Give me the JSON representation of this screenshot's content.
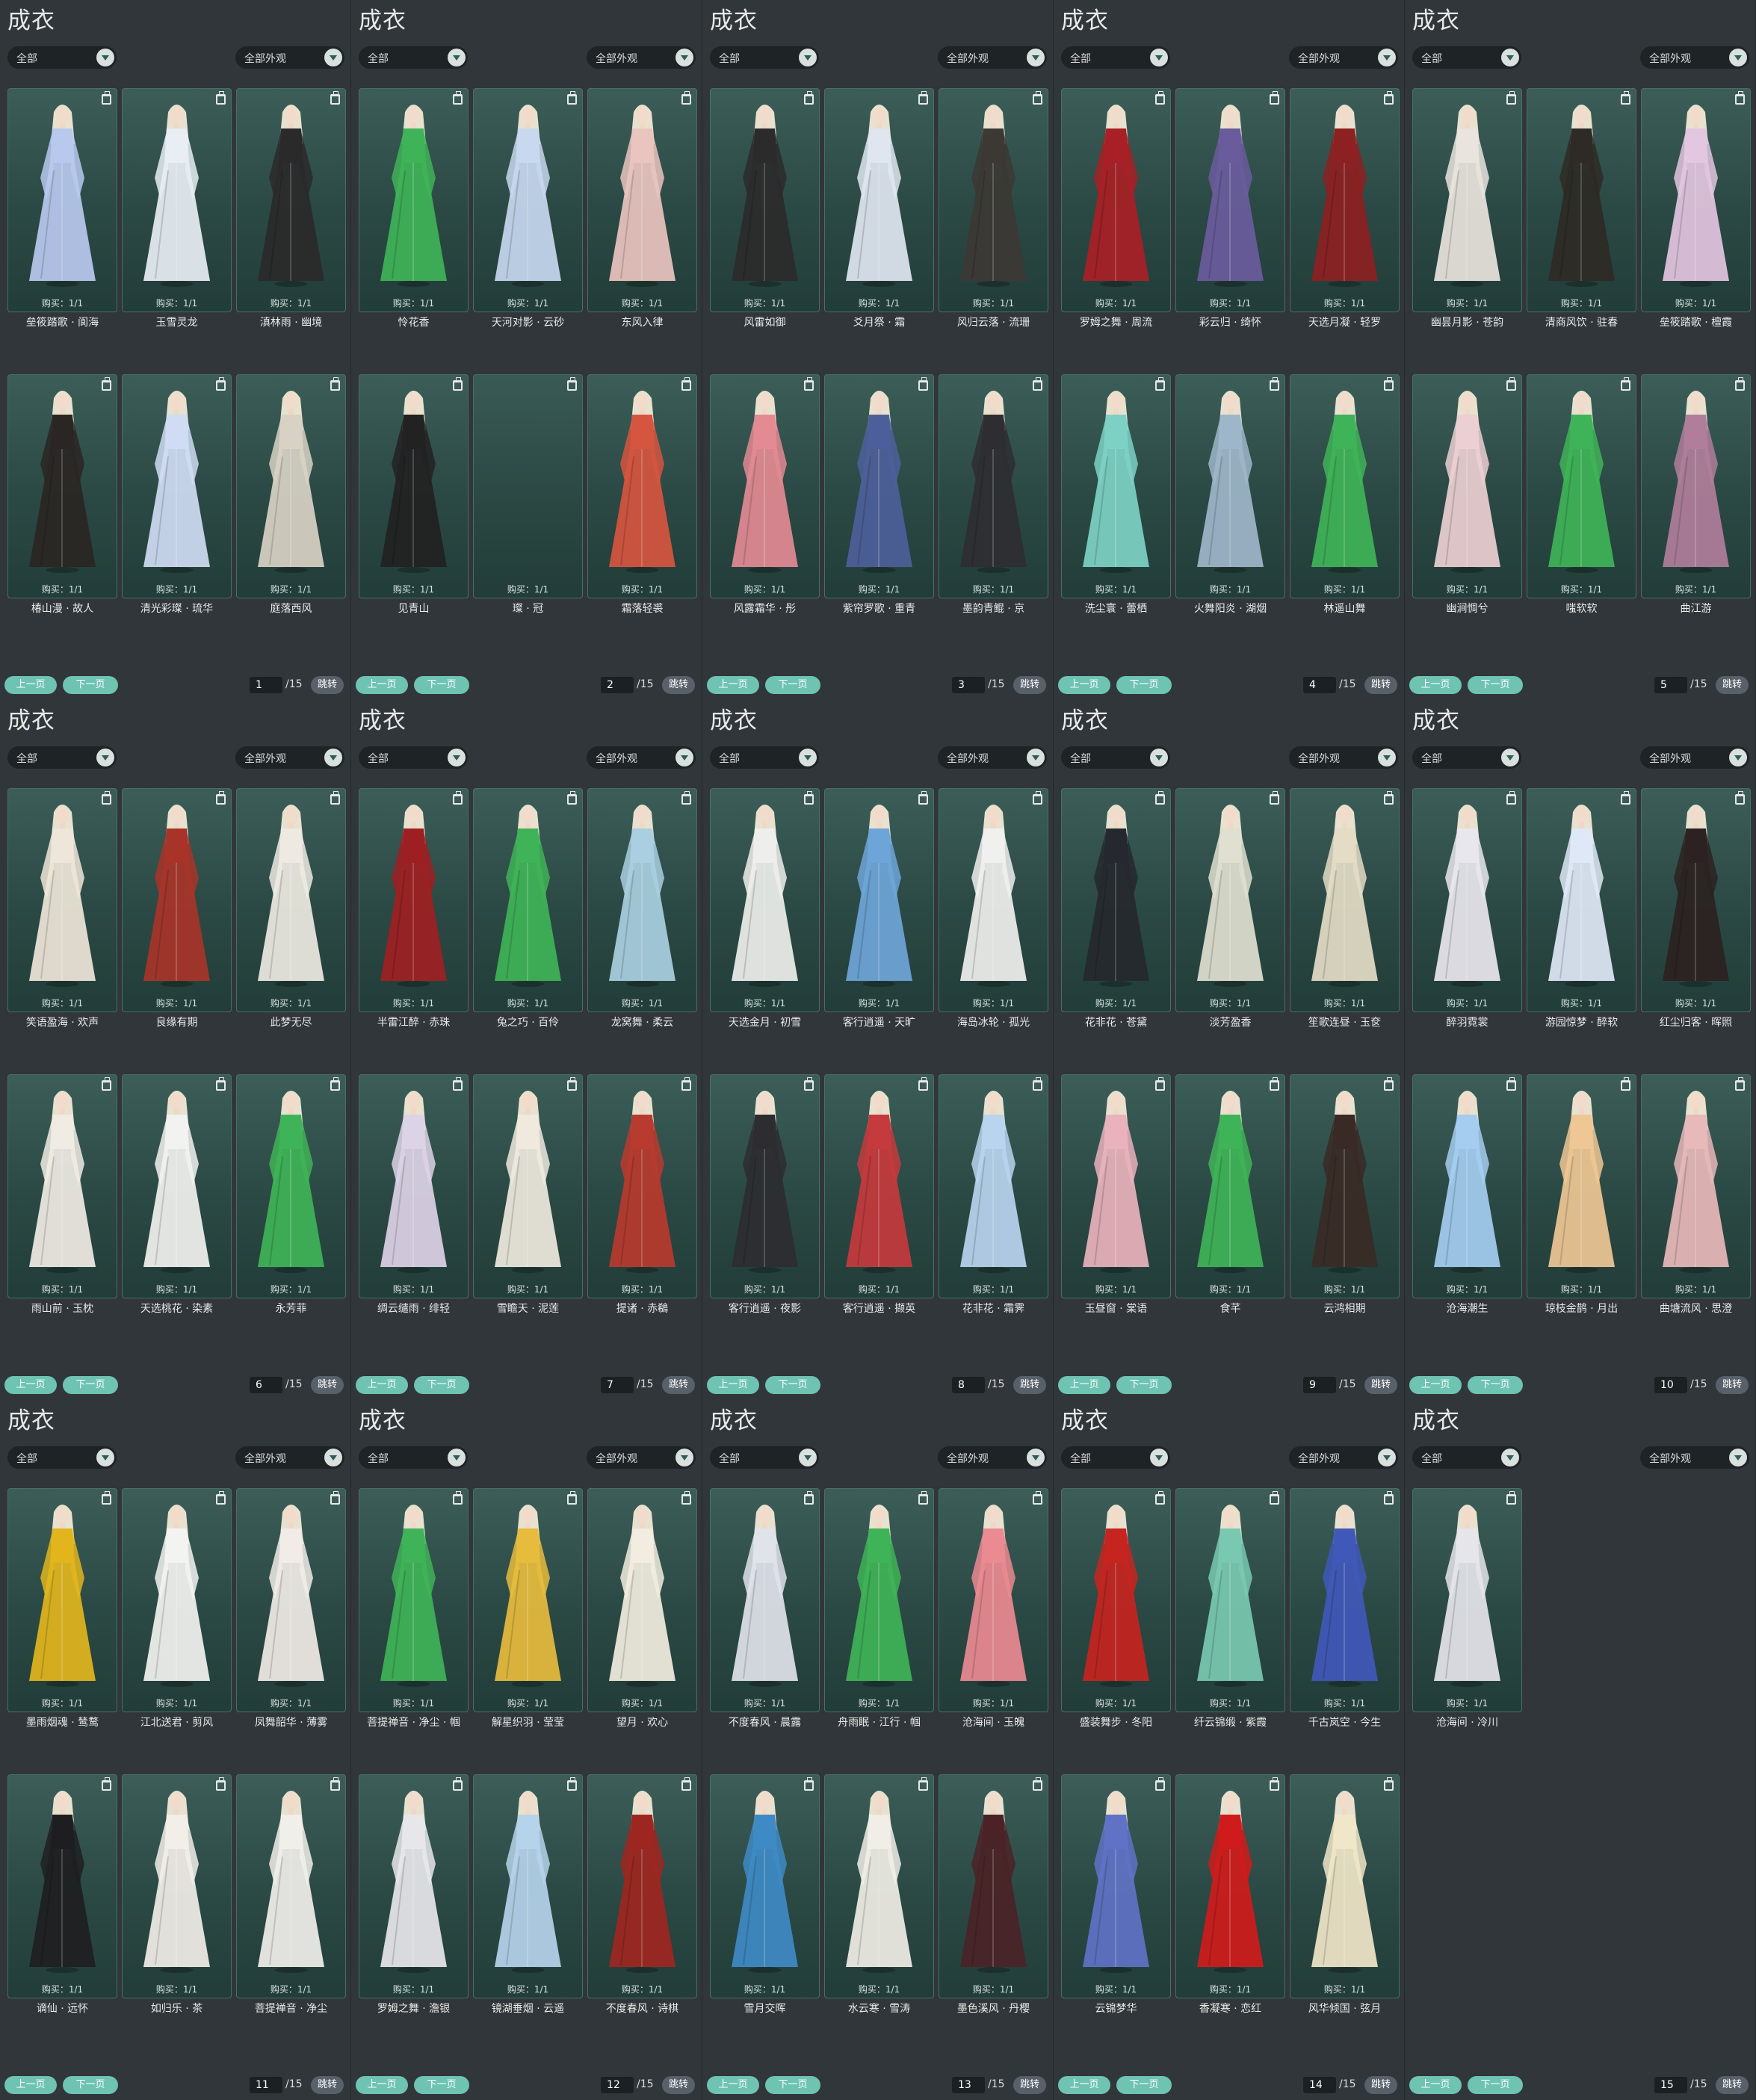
{
  "icons": {
    "trash": "trash-icon",
    "dropdown": "chevron-down-icon"
  },
  "colors": {
    "page_bg": "#30363a",
    "card_bg": "#2b4944",
    "button": "#6fc3b3"
  },
  "panels": [
    {
      "title": "成衣",
      "filter1": "全部",
      "filter2": "全部外观",
      "prev": "上一页",
      "next": "下一页",
      "page": "1",
      "total": "/15",
      "jump": "跳转",
      "items": [
        {
          "name": "垒筱踏歌 · 阆海",
          "buy": "购买：1/1",
          "color": "#b9c9ee"
        },
        {
          "name": "玉雪灵龙",
          "buy": "购买：1/1",
          "color": "#e8eef4"
        },
        {
          "name": "滇林雨 · 幽境",
          "buy": "购买：1/1",
          "color": "#2a2a2a"
        },
        {
          "name": "椿山漫 · 故人",
          "buy": "购买：1/1",
          "color": "#2a2623"
        },
        {
          "name": "清光彩璨 · 琉华",
          "buy": "购买：1/1",
          "color": "#cfdcf3"
        },
        {
          "name": "庭落西风",
          "buy": "购买：1/1",
          "color": "#d8d2c4"
        }
      ]
    },
    {
      "title": "成衣",
      "filter1": "全部",
      "filter2": "全部外观",
      "prev": "上一页",
      "next": "下一页",
      "page": "2",
      "total": "/15",
      "jump": "跳转",
      "items": [
        {
          "name": "怜花香",
          "buy": "购买：1/1",
          "color": "#3fb357"
        },
        {
          "name": "天河对影 · 云砂",
          "buy": "购买：1/1",
          "color": "#c7d8ef"
        },
        {
          "name": "东风入律",
          "buy": "购买：1/1",
          "color": "#eac4bf"
        },
        {
          "name": "见青山",
          "buy": "购买：1/1",
          "color": "#222222"
        },
        {
          "name": "璨 · 冠",
          "buy": "购买：1/1",
          "color": ""
        },
        {
          "name": "霜落轻裘",
          "buy": "购买：1/1",
          "color": "#d6553f"
        }
      ]
    },
    {
      "title": "成衣",
      "filter1": "全部",
      "filter2": "全部外观",
      "prev": "上一页",
      "next": "下一页",
      "page": "3",
      "total": "/15",
      "jump": "跳转",
      "items": [
        {
          "name": "风雷如御",
          "buy": "购买：1/1",
          "color": "#2b2b2b"
        },
        {
          "name": "爻月祭 · 霜",
          "buy": "购买：1/1",
          "color": "#dfe6f0"
        },
        {
          "name": "风归云落 · 流珊",
          "buy": "购买：1/1",
          "color": "#3c3834"
        },
        {
          "name": "风露霜华 · 彤",
          "buy": "购买：1/1",
          "color": "#e38a93"
        },
        {
          "name": "紫帘罗歌 · 重青",
          "buy": "购买：1/1",
          "color": "#4d5f9a"
        },
        {
          "name": "墨韵青鲲 · 京",
          "buy": "购买：1/1",
          "color": "#2e2e31"
        }
      ]
    },
    {
      "title": "成衣",
      "filter1": "全部",
      "filter2": "全部外观",
      "prev": "上一页",
      "next": "下一页",
      "page": "4",
      "total": "/15",
      "jump": "跳转",
      "items": [
        {
          "name": "罗姆之舞 · 周流",
          "buy": "购买：1/1",
          "color": "#a81f25"
        },
        {
          "name": "彩云归 · 绮怀",
          "buy": "购买：1/1",
          "color": "#6a5c9c"
        },
        {
          "name": "天选月凝 · 轻罗",
          "buy": "购买：1/1",
          "color": "#8d2021"
        },
        {
          "name": "洗尘寰 · 蕾栖",
          "buy": "购买：1/1",
          "color": "#7dd1c4"
        },
        {
          "name": "火舞阳炎 · 湖烟",
          "buy": "购买：1/1",
          "color": "#9eb6c9"
        },
        {
          "name": "林遥山舞",
          "buy": "购买：1/1",
          "color": "#3fb357"
        }
      ]
    },
    {
      "title": "成衣",
      "filter1": "全部",
      "filter2": "全部外观",
      "prev": "上一页",
      "next": "下一页",
      "page": "5",
      "total": "/15",
      "jump": "跳转",
      "items": [
        {
          "name": "幽昙月影 · 苍韵",
          "buy": "购买：1/1",
          "color": "#e9e4dd"
        },
        {
          "name": "清商风饮 · 驻春",
          "buy": "购买：1/1",
          "color": "#2e2a25"
        },
        {
          "name": "垒筱踏歌 · 檀霞",
          "buy": "购买：1/1",
          "color": "#e3c6df"
        },
        {
          "name": "幽涧惆兮",
          "buy": "购买：1/1",
          "color": "#eccfd3"
        },
        {
          "name": "嗤软软",
          "buy": "购买：1/1",
          "color": "#3fb357"
        },
        {
          "name": "曲江游",
          "buy": "购买：1/1",
          "color": "#b07e9a"
        }
      ]
    },
    {
      "title": "成衣",
      "filter1": "全部",
      "filter2": "全部外观",
      "prev": "上一页",
      "next": "下一页",
      "page": "6",
      "total": "/15",
      "jump": "跳转",
      "items": [
        {
          "name": "笑语盈海 · 欢声",
          "buy": "购买：1/1",
          "color": "#eee6d8"
        },
        {
          "name": "良缘有期",
          "buy": "购买：1/1",
          "color": "#a83429"
        },
        {
          "name": "此梦无尽",
          "buy": "购买：1/1",
          "color": "#eeeae2"
        },
        {
          "name": "雨山前 · 玉枕",
          "buy": "购买：1/1",
          "color": "#f0ece4"
        },
        {
          "name": "天选桃花 · 染素",
          "buy": "购买：1/1",
          "color": "#f2f2f0"
        },
        {
          "name": "永芳菲",
          "buy": "购买：1/1",
          "color": "#3fb357"
        }
      ]
    },
    {
      "title": "成衣",
      "filter1": "全部",
      "filter2": "全部外观",
      "prev": "上一页",
      "next": "下一页",
      "page": "7",
      "total": "/15",
      "jump": "跳转",
      "items": [
        {
          "name": "半雷江醉 · 赤珠",
          "buy": "购买：1/1",
          "color": "#9e1f22"
        },
        {
          "name": "兔之巧 · 百伶",
          "buy": "购买：1/1",
          "color": "#3fb357"
        },
        {
          "name": "龙窝舞 · 柔云",
          "buy": "购买：1/1",
          "color": "#a9cfe0"
        },
        {
          "name": "绸云缱雨 · 绯轻",
          "buy": "购买：1/1",
          "color": "#ddd3e6"
        },
        {
          "name": "雪瞻天 · 泥莲",
          "buy": "购买：1/1",
          "color": "#efe9de"
        },
        {
          "name": "提诸 · 赤鵗",
          "buy": "购买：1/1",
          "color": "#b93a2e"
        }
      ]
    },
    {
      "title": "成衣",
      "filter1": "全部",
      "filter2": "全部外观",
      "prev": "上一页",
      "next": "下一页",
      "page": "8",
      "total": "/15",
      "jump": "跳转",
      "items": [
        {
          "name": "天选金月 · 初雪",
          "buy": "购买：1/1",
          "color": "#eeefec"
        },
        {
          "name": "客行逍遥 · 天旷",
          "buy": "购买：1/1",
          "color": "#6ea5d8"
        },
        {
          "name": "海岛冰轮 · 孤光",
          "buy": "购买：1/1",
          "color": "#f0f0ee"
        },
        {
          "name": "客行逍遥 · 夜影",
          "buy": "购买：1/1",
          "color": "#2d2d30"
        },
        {
          "name": "客行逍遥 · 撷英",
          "buy": "购买：1/1",
          "color": "#c53a3c"
        },
        {
          "name": "花非花 · 霜霁",
          "buy": "购买：1/1",
          "color": "#b9d4ee"
        }
      ]
    },
    {
      "title": "成衣",
      "filter1": "全部",
      "filter2": "全部外观",
      "prev": "上一页",
      "next": "下一页",
      "page": "9",
      "total": "/15",
      "jump": "跳转",
      "items": [
        {
          "name": "花非花 · 苍黛",
          "buy": "购买：1/1",
          "color": "#25282e"
        },
        {
          "name": "淡芳盈香",
          "buy": "购买：1/1",
          "color": "#dfe0cf"
        },
        {
          "name": "笙歌连昼 · 玉奁",
          "buy": "购买：1/1",
          "color": "#e4dcc5"
        },
        {
          "name": "玉昼窗 · 棠语",
          "buy": "购买：1/1",
          "color": "#e9b2bc"
        },
        {
          "name": "食芊",
          "buy": "购买：1/1",
          "color": "#3fb357"
        },
        {
          "name": "云鸿相期",
          "buy": "购买：1/1",
          "color": "#3a2a25"
        }
      ]
    },
    {
      "title": "成衣",
      "filter1": "全部",
      "filter2": "全部外观",
      "prev": "上一页",
      "next": "下一页",
      "page": "10",
      "total": "/15",
      "jump": "跳转",
      "items": [
        {
          "name": "醉羽霓裳",
          "buy": "购买：1/1",
          "color": "#e9e7ee"
        },
        {
          "name": "游园惊梦 · 醉软",
          "buy": "购买：1/1",
          "color": "#dfe8f6"
        },
        {
          "name": "红尘归客 · 晖照",
          "buy": "购买：1/1",
          "color": "#2b2221"
        },
        {
          "name": "沧海潮生",
          "buy": "购买：1/1",
          "color": "#a4cdf0"
        },
        {
          "name": "琼枝金鹊 · 月出",
          "buy": "购买：1/1",
          "color": "#efc794"
        },
        {
          "name": "曲塘流风 · 思澄",
          "buy": "购买：1/1",
          "color": "#e8b9b9"
        }
      ]
    },
    {
      "title": "成衣",
      "filter1": "全部",
      "filter2": "全部外观",
      "prev": "上一页",
      "next": "下一页",
      "page": "11",
      "total": "/15",
      "jump": "跳转",
      "items": [
        {
          "name": "墨雨烟魂 · 鸶鹜",
          "buy": "购买：1/1",
          "color": "#e2b51d"
        },
        {
          "name": "江北送君 · 剪风",
          "buy": "购买：1/1",
          "color": "#f3f3f1"
        },
        {
          "name": "凤舞韶华 · 薄雾",
          "buy": "购买：1/1",
          "color": "#f1ece7"
        },
        {
          "name": "谪仙 · 远怀",
          "buy": "购买：1/1",
          "color": "#1e1e20"
        },
        {
          "name": "如归乐 · 茶",
          "buy": "购买：1/1",
          "color": "#f2eee8"
        },
        {
          "name": "菩提禅音 · 净尘",
          "buy": "购买：1/1",
          "color": "#f1efea"
        }
      ]
    },
    {
      "title": "成衣",
      "filter1": "全部",
      "filter2": "全部外观",
      "prev": "上一页",
      "next": "下一页",
      "page": "12",
      "total": "/15",
      "jump": "跳转",
      "items": [
        {
          "name": "菩提禅音 · 净尘 · 帼",
          "buy": "购买：1/1",
          "color": "#3fb357"
        },
        {
          "name": "解星织羽 · 莹莹",
          "buy": "购买：1/1",
          "color": "#e7bc3d"
        },
        {
          "name": "望月 · 欢心",
          "buy": "购买：1/1",
          "color": "#f2ede0"
        },
        {
          "name": "罗姆之舞 · 澹银",
          "buy": "购买：1/1",
          "color": "#e7e7ea"
        },
        {
          "name": "镜湖垂烟 · 云遥",
          "buy": "购买：1/1",
          "color": "#b5d3ea"
        },
        {
          "name": "不度春风 · 诗棋",
          "buy": "购买：1/1",
          "color": "#9e2620"
        }
      ]
    },
    {
      "title": "成衣",
      "filter1": "全部",
      "filter2": "全部外观",
      "prev": "上一页",
      "next": "下一页",
      "page": "13",
      "total": "/15",
      "jump": "跳转",
      "items": [
        {
          "name": "不度春风 · 晨露",
          "buy": "购买：1/1",
          "color": "#dfe3ea"
        },
        {
          "name": "舟雨眠 · 江行 · 帼",
          "buy": "购买：1/1",
          "color": "#3fb357"
        },
        {
          "name": "沧海间 · 玉魄",
          "buy": "购买：1/1",
          "color": "#ea8a91"
        },
        {
          "name": "雪月交晖",
          "buy": "购买：1/1",
          "color": "#3e8ac4"
        },
        {
          "name": "水云寒 · 雪涛",
          "buy": "购买：1/1",
          "color": "#f0eee6"
        },
        {
          "name": "墨色溪风 · 丹樱",
          "buy": "购买：1/1",
          "color": "#4b2326"
        }
      ]
    },
    {
      "title": "成衣",
      "filter1": "全部",
      "filter2": "全部外观",
      "prev": "上一页",
      "next": "下一页",
      "page": "14",
      "total": "/15",
      "jump": "跳转",
      "items": [
        {
          "name": "盛装舞步 · 冬阳",
          "buy": "购买：1/1",
          "color": "#c5241f"
        },
        {
          "name": "纤云锦缎 · 紫霞",
          "buy": "购买：1/1",
          "color": "#79c9b0"
        },
        {
          "name": "千古岚空 · 今生",
          "buy": "购买：1/1",
          "color": "#4058b8"
        },
        {
          "name": "云锦梦华",
          "buy": "购买：1/1",
          "color": "#5f72c6"
        },
        {
          "name": "香凝寒 · 恋红",
          "buy": "购买：1/1",
          "color": "#cf1b1b"
        },
        {
          "name": "风华倾国 · 弦月",
          "buy": "购买：1/1",
          "color": "#f0e6c8"
        }
      ]
    },
    {
      "title": "成衣",
      "filter1": "全部",
      "filter2": "全部外观",
      "prev": "上一页",
      "next": "下一页",
      "page": "15",
      "total": "/15",
      "jump": "跳转",
      "items": [
        {
          "name": "沧海间 · 冷川",
          "buy": "购买：1/1",
          "color": "#e5e5ea"
        }
      ]
    }
  ]
}
